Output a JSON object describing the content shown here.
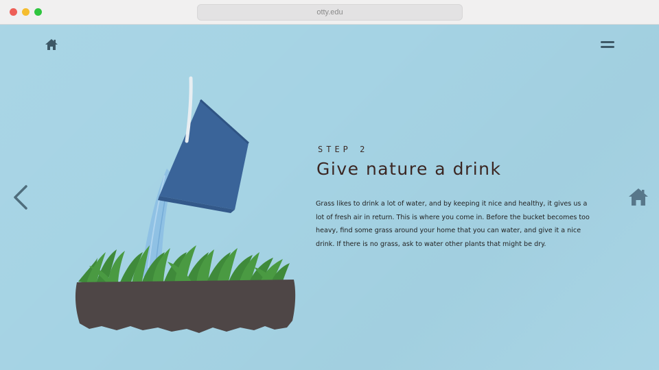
{
  "browser": {
    "url": "otty.edu"
  },
  "nav": {
    "home_icon": "home-icon",
    "menu_icon": "hamburger-menu-icon",
    "prev_icon": "chevron-left-icon",
    "next_icon": "home-icon"
  },
  "content": {
    "step_label": "STEP 2",
    "title": "Give nature a drink",
    "body": "Grass likes to drink a lot of water, and by keeping it nice and healthy, it gives us a lot of fresh air in return. This is where you come in. Before the bucket becomes too heavy, find some grass around your home that you can water, and give it a nice drink. If there is no grass, ask to water other plants that might be dry."
  },
  "colors": {
    "background": "#a5d3e4",
    "bucket": "#3a6499",
    "soil": "#4e4646",
    "grass": "#3f8a3a",
    "water": "#7fb4dc",
    "icon": "#3d5866"
  }
}
